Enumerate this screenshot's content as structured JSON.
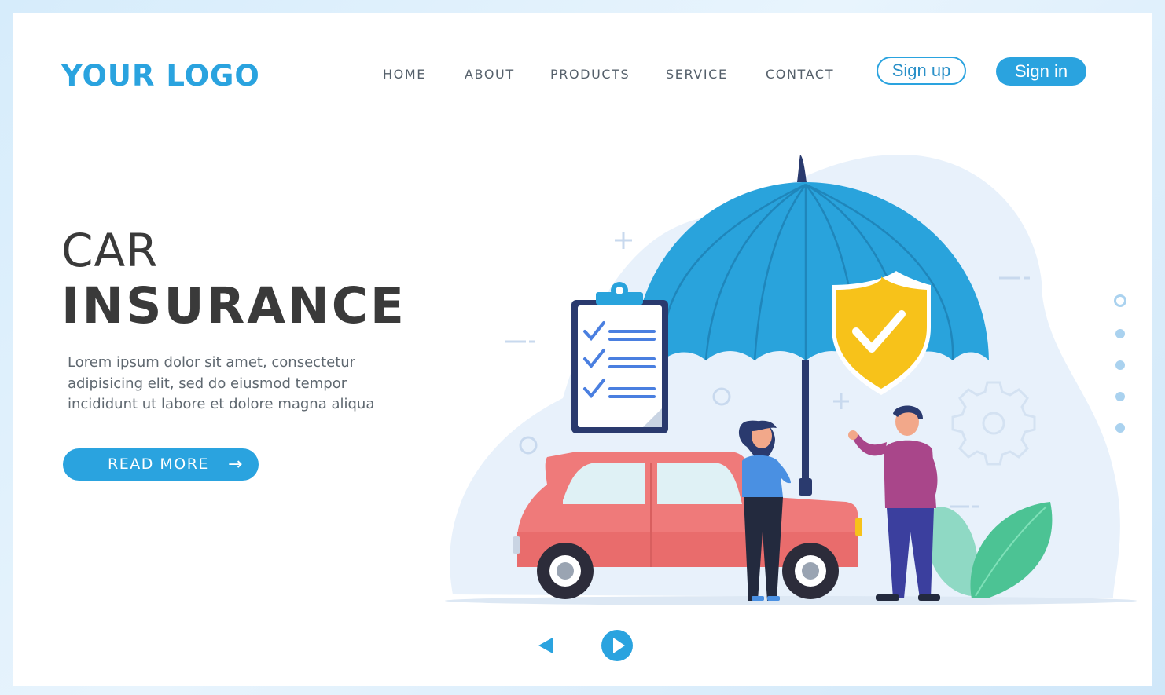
{
  "brand": {
    "logo_text": "YOUR LOGO"
  },
  "nav": {
    "items": [
      {
        "label": "HOME"
      },
      {
        "label": "ABOUT"
      },
      {
        "label": "PRODUCTS"
      },
      {
        "label": "SERVICE"
      },
      {
        "label": "CONTACT"
      }
    ],
    "signup_label": "Sign up",
    "signin_label": "Sign in"
  },
  "hero": {
    "title_line1": "CAR",
    "title_line2": "INSURANCE",
    "description": "Lorem ipsum dolor sit amet, consectetur adipisicing elit, sed do eiusmod tempor incididunt ut labore et dolore magna aliqua",
    "cta_label": "READ MORE",
    "cta_icon": "arrow-right-icon"
  },
  "pagination": {
    "count": 5,
    "active_index": 0
  },
  "colors": {
    "brand_blue": "#2aa3df",
    "umbrella_blue": "#29a3dc",
    "shield_yellow": "#f7c21a",
    "car_red": "#ef7a7a",
    "leaf_green": "#59c9a0",
    "text_dark": "#3a3a3a"
  }
}
